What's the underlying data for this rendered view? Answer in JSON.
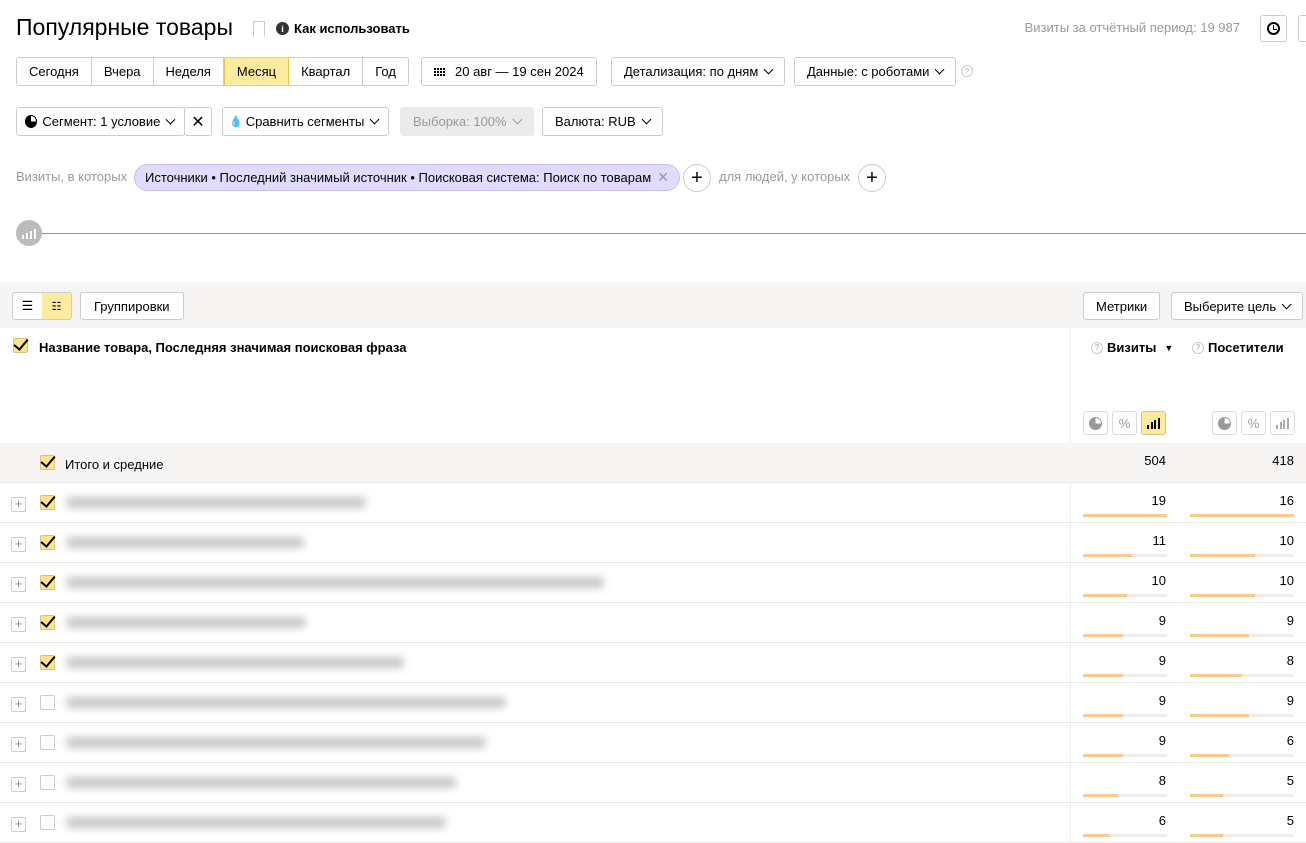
{
  "header": {
    "title": "Популярные товары",
    "how_to": "Как использовать",
    "visits_total": "Визиты за отчётный период: 19 987",
    "info_icon": "info-icon",
    "bookmark_icon": "bookmark-icon",
    "clock_icon": "clock-icon"
  },
  "period": {
    "buttons": [
      "Сегодня",
      "Вчера",
      "Неделя",
      "Месяц",
      "Квартал",
      "Год"
    ],
    "selected": "Месяц",
    "date_range": "20 авг — 19 сен 2024",
    "detail": "Детализация: по дням",
    "data": "Данные: с роботами"
  },
  "filters": {
    "segment": "Сегмент: 1 условие",
    "compare": "Сравнить сегменты",
    "sample": "Выборка: 100%",
    "currency": "Валюта: RUB"
  },
  "condition": {
    "visits_label": "Визиты, в которых",
    "chip": "Источники • Последний значимый источник • Поисковая система: Поиск по товарам",
    "people_label": "для людей, у которых"
  },
  "table_toolbar": {
    "groupings": "Группировки",
    "metrics": "Метрики",
    "goal": "Выберите цель"
  },
  "table": {
    "dimension_header": "Название товара, Последняя значимая поисковая фраза",
    "columns": [
      {
        "label": "Визиты",
        "sorted": "desc"
      },
      {
        "label": "Посетители"
      }
    ],
    "sort_icon": "▼",
    "totals": {
      "label": "Итого и средние",
      "values": [
        504,
        418
      ]
    },
    "rows": [
      {
        "checked": true,
        "values": [
          19,
          16
        ]
      },
      {
        "checked": true,
        "values": [
          11,
          10
        ]
      },
      {
        "checked": true,
        "values": [
          10,
          10
        ]
      },
      {
        "checked": true,
        "values": [
          9,
          9
        ]
      },
      {
        "checked": true,
        "values": [
          9,
          8
        ]
      },
      {
        "checked": false,
        "values": [
          9,
          9
        ]
      },
      {
        "checked": false,
        "values": [
          9,
          6
        ]
      },
      {
        "checked": false,
        "values": [
          8,
          5
        ]
      },
      {
        "checked": false,
        "values": [
          6,
          5
        ]
      }
    ]
  },
  "colors": {
    "accent": "#ffeba0",
    "chip": "#dfdcff",
    "bar": "#fbc98e"
  }
}
